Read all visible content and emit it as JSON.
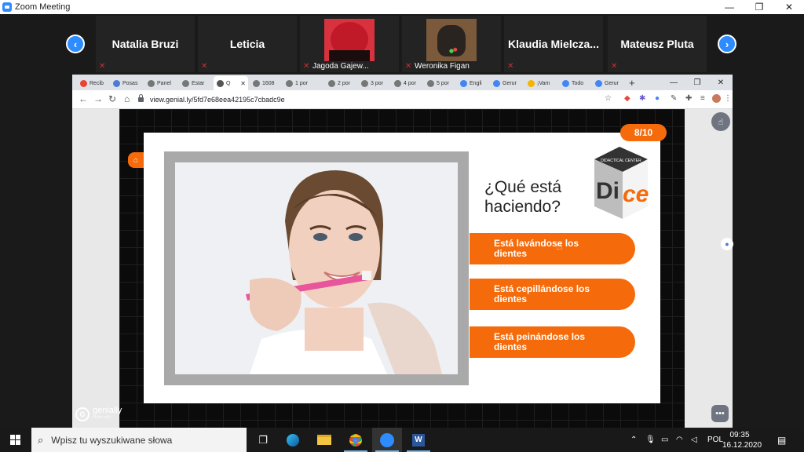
{
  "zoom": {
    "title": "Zoom Meeting",
    "window_controls": [
      "—",
      "❐",
      "✕"
    ],
    "nav_prev": "‹",
    "nav_next": "›",
    "participants": [
      {
        "name": "Natalia Bruzi",
        "kind": "name",
        "mic": "muted"
      },
      {
        "name": "Leticia",
        "kind": "name",
        "mic": "muted"
      },
      {
        "name": "Jagoda Gajew...",
        "kind": "photo",
        "mic": "muted"
      },
      {
        "name": "Weronika Figan",
        "kind": "photo",
        "mic": "muted"
      },
      {
        "name": "Klaudia  Mielcza...",
        "kind": "name",
        "mic": "muted"
      },
      {
        "name": "Mateusz Pluta",
        "kind": "name",
        "mic": "muted"
      }
    ]
  },
  "browser": {
    "tabs": [
      {
        "label": "Recib",
        "favicon": "gmail",
        "color": "#ea4335"
      },
      {
        "label": "Posas",
        "favicon": "meet",
        "color": "#4a7bd6"
      },
      {
        "label": "Panel",
        "favicon": "chrome",
        "color": "#777777"
      },
      {
        "label": "Estar",
        "favicon": "chrome",
        "color": "#777777"
      },
      {
        "label": "Q",
        "favicon": "chrome",
        "color": "#555555",
        "active": true
      },
      {
        "label": "1608",
        "favicon": "chrome",
        "color": "#777777"
      },
      {
        "label": "1 por",
        "favicon": "chrome",
        "color": "#777777"
      },
      {
        "label": "2 por",
        "favicon": "chrome",
        "color": "#777777"
      },
      {
        "label": "3 por",
        "favicon": "chrome",
        "color": "#777777"
      },
      {
        "label": "4 por",
        "favicon": "chrome",
        "color": "#777777"
      },
      {
        "label": "5 por",
        "favicon": "chrome",
        "color": "#777777"
      },
      {
        "label": "Engli",
        "favicon": "google",
        "color": "#4285f4"
      },
      {
        "label": "Gerur",
        "favicon": "google",
        "color": "#4285f4"
      },
      {
        "label": "¡Vam",
        "favicon": "drive",
        "color": "#f4b400"
      },
      {
        "label": "Todo",
        "favicon": "google",
        "color": "#4285f4"
      },
      {
        "label": "Gerur",
        "favicon": "google",
        "color": "#4285f4"
      }
    ],
    "new_tab": "+",
    "window_controls": [
      "—",
      "❐",
      "✕"
    ],
    "url": "view.genial.ly/5fd7e68eea42195c7cbadc9e"
  },
  "slide": {
    "counter": "8/10",
    "question_line1": "¿Qué está",
    "question_line2": "haciendo?",
    "logo_top": "DIDACTICAL CENTER",
    "logo_di": "Di",
    "logo_ce": "ce",
    "answers": [
      {
        "line1": "Está lavándose los",
        "line2": "dientes"
      },
      {
        "line1": "Está cepillándose los",
        "line2": "dientes"
      },
      {
        "line1": "Está peinándose los",
        "line2": "dientes"
      }
    ],
    "brand": "genially",
    "brand_sub": "Made with"
  },
  "taskbar": {
    "search_placeholder": "Wpisz tu wyszukiwane słowa",
    "language": "POL",
    "time": "09:35",
    "date": "16.12.2020"
  },
  "colors": {
    "accent_orange": "#f56a0a",
    "zoom_blue": "#2d8cff"
  }
}
